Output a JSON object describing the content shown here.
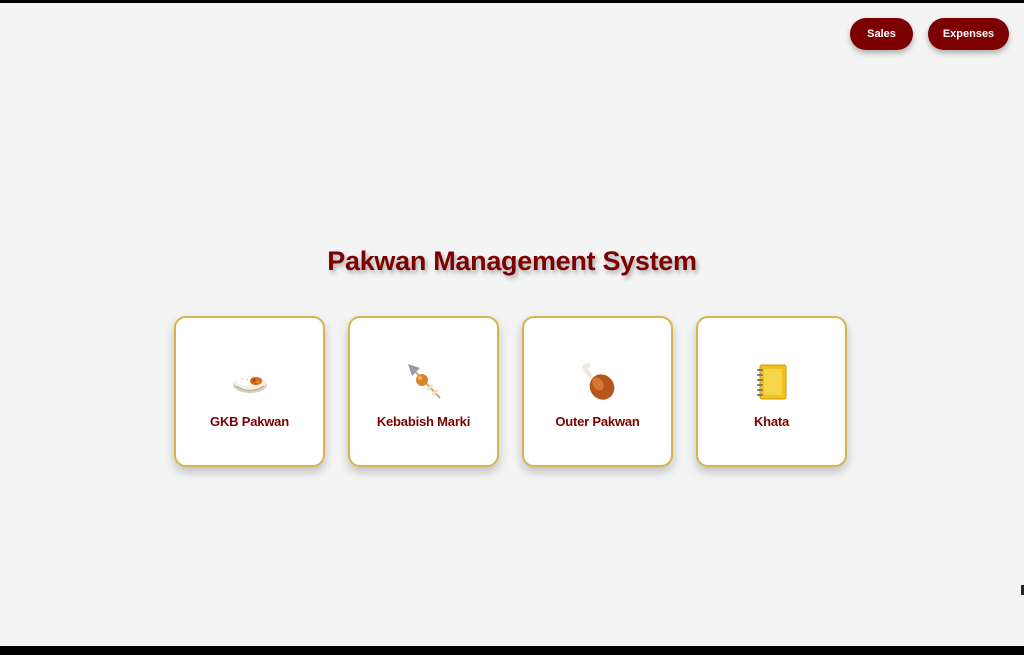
{
  "header": {
    "buttons": [
      {
        "label": "Sales"
      },
      {
        "label": "Expenses"
      }
    ]
  },
  "main": {
    "title": "Pakwan Management System",
    "cards": [
      {
        "label": "GKB Pakwan",
        "icon": "rice-bowl-icon"
      },
      {
        "label": "Kebabish Marki",
        "icon": "kebab-skewer-icon"
      },
      {
        "label": "Outer Pakwan",
        "icon": "chicken-leg-icon"
      },
      {
        "label": "Khata",
        "icon": "notebook-icon"
      }
    ]
  },
  "colors": {
    "accent": "#7c0000",
    "card_border": "#d8b44a",
    "background": "#f4f4f4"
  }
}
